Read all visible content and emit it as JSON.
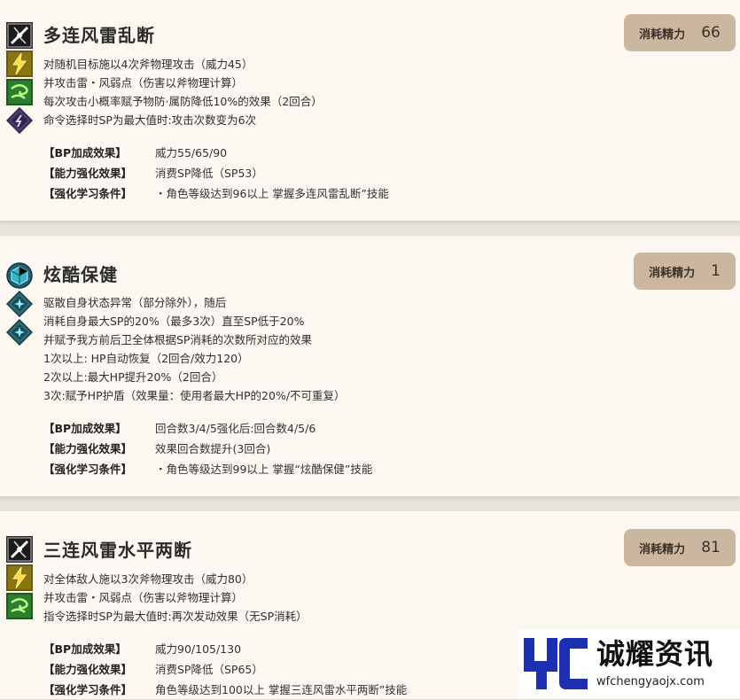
{
  "cards": [
    {
      "title": "多连风雷乱断",
      "cost_label": "消耗精力",
      "cost_value": "66",
      "icons": [
        "slash-icon",
        "lightning-icon",
        "wind-icon",
        "dark-icon"
      ],
      "desc": [
        "对随机目标施以4次斧物理攻击（威力45）",
        "并攻击雷・风弱点（伤害以斧物理计算）",
        "每次攻击小概率赋予物防·属防降低10%的效果（2回合）",
        "命令选择时SP为最大值时:攻击次数变为6次"
      ],
      "attrs": [
        {
          "key": "【BP加成效果】",
          "val": "威力55/65/90"
        },
        {
          "key": "【能力强化效果】",
          "val": "消费SP降低（SP53）"
        },
        {
          "key": "【强化学习条件】",
          "val": "・角色等级达到96以上 掌握多连风雷乱断”技能"
        }
      ]
    },
    {
      "title": "炫酷保健",
      "cost_label": "消耗精力",
      "cost_value": "1",
      "icons": [
        "shield-cube-icon",
        "light-diamond-icon",
        "light-diamond-icon"
      ],
      "desc": [
        "驱散自身状态异常（部分除外），随后",
        "消耗自身最大SP的20%（最多3次）直至SP低于20%",
        "并赋予我方前后卫全体根据SP消耗的次数所对应的效果",
        "1次以上: HP自动恢复（2回合/效力120）",
        "2次以上:最大HP提升20%（2回合）",
        "3次:赋予HP护盾（效果量：使用者最大HP的20%/不可重复）"
      ],
      "attrs": [
        {
          "key": "【BP加成效果】",
          "val": "回合数3/4/5强化后:回合数4/5/6"
        },
        {
          "key": "【能力强化效果】",
          "val": "效果回合数提升(3回合)"
        },
        {
          "key": "【强化学习条件】",
          "val": "・角色等级达到99以上 掌握“炫酷保健”技能"
        }
      ]
    },
    {
      "title": "三连风雷水平两断",
      "cost_label": "消耗精力",
      "cost_value": "81",
      "icons": [
        "slash-icon",
        "lightning-icon",
        "wind-icon"
      ],
      "desc": [
        "对全体敌人施以3次斧物理攻击（威力80）",
        "并攻击雷・风弱点（伤害以斧物理计算）",
        "指令选择时SP为最大值时:再次发动效果（无SP消耗）"
      ],
      "attrs": [
        {
          "key": "【BP加成效果】",
          "val": "威力90/105/130"
        },
        {
          "key": "【能力强化效果】",
          "val": "消费SP降低（SP65）"
        },
        {
          "key": "【强化学习条件】",
          "val": "角色等级达到100以上 掌握三连风雷水平两断”技能"
        }
      ]
    }
  ],
  "watermark": {
    "title": "诚耀资讯",
    "url": "wfchengyaojx.com"
  },
  "colors": {
    "card_bg": "#fcf8f1",
    "page_bg": "#e7e3dc",
    "cost_badge": "#cbb79f"
  }
}
